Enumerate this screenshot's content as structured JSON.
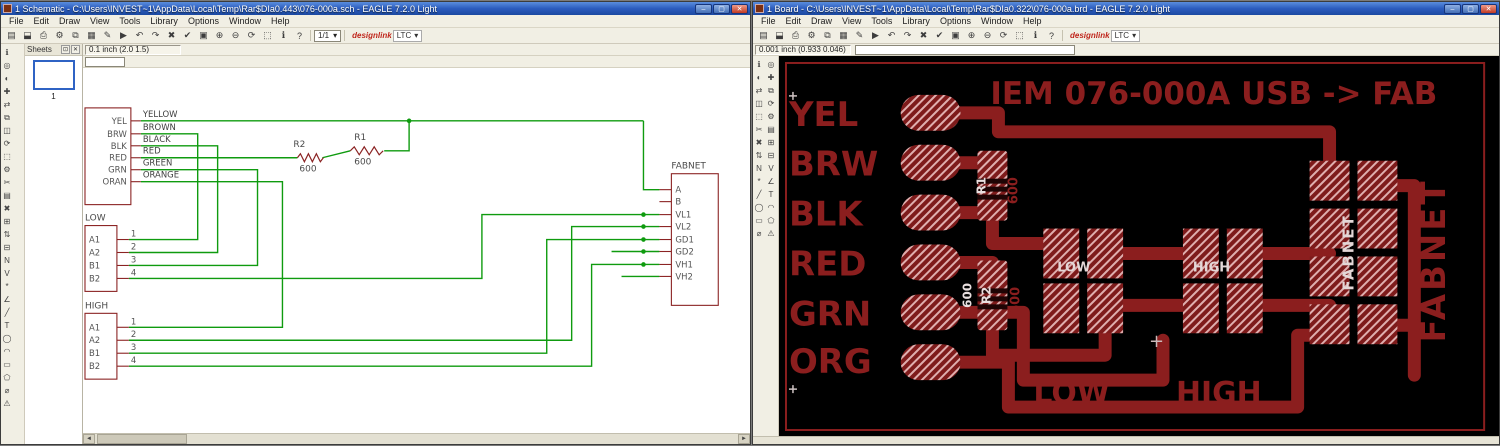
{
  "menus": [
    "File",
    "Edit",
    "Draw",
    "View",
    "Tools",
    "Library",
    "Options",
    "Window",
    "Help"
  ],
  "win_controls": {
    "min": "–",
    "max": "▢",
    "close": "✕"
  },
  "brand": {
    "logo": "designlink",
    "lib": "LTC",
    "caret": "▾"
  },
  "toolbar_icons": [
    {
      "n": "open-icon",
      "g": "▤"
    },
    {
      "n": "save-icon",
      "g": "⬓"
    },
    {
      "n": "print-icon",
      "g": "⎙"
    },
    {
      "n": "cam-processor-icon",
      "g": "⚙"
    },
    {
      "n": "switch-editor-icon",
      "g": "⧉"
    },
    {
      "n": "use-library-icon",
      "g": "▦"
    },
    {
      "n": "script-icon",
      "g": "✎"
    },
    {
      "n": "run-icon",
      "g": "▶"
    },
    {
      "n": "undo-icon",
      "g": "↶"
    },
    {
      "n": "redo-icon",
      "g": "↷"
    },
    {
      "n": "stop-icon",
      "g": "✖"
    },
    {
      "n": "go-icon",
      "g": "✔"
    },
    {
      "n": "zoom-fit-icon",
      "g": "▣"
    },
    {
      "n": "zoom-in-icon",
      "g": "⊕"
    },
    {
      "n": "zoom-out-icon",
      "g": "⊖"
    },
    {
      "n": "zoom-redraw-icon",
      "g": "⟳"
    },
    {
      "n": "zoom-select-icon",
      "g": "⬚"
    },
    {
      "n": "info-toolbar-icon",
      "g": "ℹ"
    },
    {
      "n": "help-icon",
      "g": "?"
    }
  ],
  "side_tools": [
    {
      "n": "info-tool-icon",
      "g": "ℹ"
    },
    {
      "n": "show-tool-icon",
      "g": "◎"
    },
    {
      "n": "display-tool-icon",
      "g": "◐"
    },
    {
      "n": "mark-tool-icon",
      "g": "✚"
    },
    {
      "n": "move-tool-icon",
      "g": "⇄"
    },
    {
      "n": "copy-tool-icon",
      "g": "⧉"
    },
    {
      "n": "mirror-tool-icon",
      "g": "◫"
    },
    {
      "n": "rotate-tool-icon",
      "g": "⟳"
    },
    {
      "n": "group-tool-icon",
      "g": "⬚"
    },
    {
      "n": "change-tool-icon",
      "g": "⚙"
    },
    {
      "n": "cut-tool-icon",
      "g": "✂"
    },
    {
      "n": "paste-tool-icon",
      "g": "▤"
    },
    {
      "n": "delete-tool-icon",
      "g": "✖"
    },
    {
      "n": "add-tool-icon",
      "g": "⊞"
    },
    {
      "n": "pinswap-tool-icon",
      "g": "⇅"
    },
    {
      "n": "replace-tool-icon",
      "g": "⊟"
    },
    {
      "n": "name-tool-icon",
      "g": "N"
    },
    {
      "n": "value-tool-icon",
      "g": "V"
    },
    {
      "n": "smash-tool-icon",
      "g": "*"
    },
    {
      "n": "miter-tool-icon",
      "g": "∠"
    },
    {
      "n": "wire-tool-icon",
      "g": "╱"
    },
    {
      "n": "text-tool-icon",
      "g": "T"
    },
    {
      "n": "circle-tool-icon",
      "g": "◯"
    },
    {
      "n": "arc-tool-icon",
      "g": "◠"
    },
    {
      "n": "rect-tool-icon",
      "g": "▭"
    },
    {
      "n": "polygon-tool-icon",
      "g": "⬠"
    },
    {
      "n": "via-tool-icon",
      "g": "⌀"
    },
    {
      "n": "errors-tool-icon",
      "g": "⚠"
    }
  ],
  "schematic_window": {
    "title": "1 Schematic - C:\\Users\\INVEST~1\\AppData\\Local\\Temp\\Rar$DIa0.443\\076-000a.sch - EAGLE 7.2.0 Light",
    "sheet_selector": "1/1",
    "coord_readout": "0.1 inch (2.0 1.5)",
    "sheets_panel": {
      "title": "Sheets",
      "thumb_label": "1"
    },
    "schematic": {
      "conn_pins": [
        "YEL",
        "BRW",
        "BLK",
        "RED",
        "GRN",
        "ORAN"
      ],
      "net_labels": [
        "YELLOW",
        "BROWN",
        "BLACK",
        "RED",
        "GREEN",
        "ORANGE"
      ],
      "r1": {
        "name": "R1",
        "value": "600"
      },
      "r2": {
        "name": "R2",
        "value": "600"
      },
      "fabnet": {
        "name": "FABNET",
        "pins": [
          "A",
          "B",
          "VL1",
          "VL2",
          "GD1",
          "GD2",
          "VH1",
          "VH2"
        ]
      },
      "low": {
        "name": "LOW",
        "pins": [
          "A1",
          "A2",
          "B1",
          "B2"
        ],
        "numbers": [
          "1",
          "2",
          "3",
          "4"
        ]
      },
      "high": {
        "name": "HIGH",
        "pins": [
          "A1",
          "A2",
          "B1",
          "B2"
        ],
        "numbers": [
          "1",
          "2",
          "3",
          "4"
        ]
      }
    }
  },
  "board_window": {
    "title": "1 Board - C:\\Users\\INVEST~1\\AppData\\Local\\Temp\\Rar$DIa0.322\\076-000a.brd - EAGLE 7.2.0 Light",
    "coord_readout": "0.001 inch (0.933 0.046)",
    "board": {
      "title_text": "IEM 076-000A  USB -> FAB",
      "left_labels": [
        "YEL",
        "BRW",
        "BLK",
        "RED",
        "GRN",
        "ORG"
      ],
      "r1": {
        "name": "R1",
        "value": "600"
      },
      "r2": {
        "name": "R2",
        "value": "600"
      },
      "low_label": "LOW",
      "high_label": "HIGH",
      "low_bottom": "LOW",
      "high_bottom": "HIGH",
      "fabnet_white": "FABNET",
      "fabnet_red": "FABNET",
      "plus_mark": "+"
    }
  },
  "colors": {
    "copper": "#8b1e1e",
    "hatch_light": "#dfaeae",
    "net_green": "#0f9b0f",
    "symbol_red": "#8b2323",
    "board_bg": "#000000",
    "titlebar_blue": "#2c5cbe"
  }
}
